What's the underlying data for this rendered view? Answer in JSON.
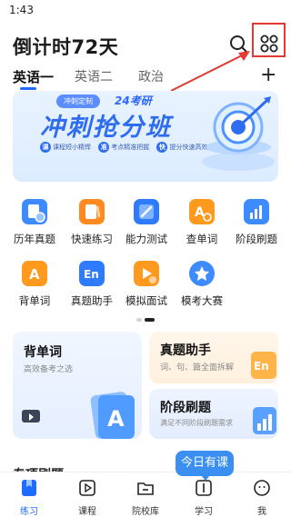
{
  "status_bar": {
    "time": "1:43"
  },
  "header": {
    "title": "倒计时72天",
    "search_icon": "search-icon",
    "apps_icon": "apps-grid-icon"
  },
  "annotation": {
    "highlight_color": "#e53935"
  },
  "tabs": [
    {
      "label": "英语一",
      "active": true
    },
    {
      "label": "英语二",
      "active": false
    },
    {
      "label": "政治",
      "active": false
    }
  ],
  "add_tab_label": "+",
  "banner": {
    "badge": "冲刺定制",
    "subtitle": "24考研",
    "title": "冲刺抢分班",
    "tags": [
      {
        "mark": "课",
        "text": "课程短小精悍"
      },
      {
        "mark": "准",
        "text": "考点精准把握"
      },
      {
        "mark": "快",
        "text": "提分快速高效"
      }
    ]
  },
  "grid": [
    {
      "label": "历年真题",
      "icon": "calendar-book-icon",
      "color": "#3d8bff"
    },
    {
      "label": "快速练习",
      "icon": "note-pen-icon",
      "color": "#ff8a1f"
    },
    {
      "label": "能力测试",
      "icon": "test-pen-icon",
      "color": "#2f7bff"
    },
    {
      "label": "查单词",
      "icon": "letter-a-search-icon",
      "color": "#ff9a1f"
    },
    {
      "label": "阶段刷题",
      "icon": "bar-chart-icon",
      "color": "#3d8bff"
    },
    {
      "label": "背单词",
      "icon": "letter-a-card-icon",
      "color": "#ff9a1f"
    },
    {
      "label": "真题助手",
      "icon": "en-card-icon",
      "color": "#2f7bff"
    },
    {
      "label": "模拟面试",
      "icon": "play-video-icon",
      "color": "#ff9a1f"
    },
    {
      "label": "模考大赛",
      "icon": "trophy-star-icon",
      "color": "#3d8bff"
    }
  ],
  "cards": {
    "vocab": {
      "title": "背单词",
      "subtitle": "高效备考之选"
    },
    "exam_helper": {
      "title": "真题助手",
      "subtitle": "词、句、篇全面拆解"
    },
    "stage_practice": {
      "title": "阶段刷题",
      "subtitle": "满足不同阶段刷题需求"
    }
  },
  "section_peek": "专项刷题",
  "today_bubble": "今日有课",
  "bottom_nav": [
    {
      "label": "练习",
      "icon": "practice-bookmark-icon",
      "active": true
    },
    {
      "label": "课程",
      "icon": "course-play-icon",
      "active": false
    },
    {
      "label": "院校库",
      "icon": "school-folder-icon",
      "active": false
    },
    {
      "label": "学习",
      "icon": "study-book-icon",
      "active": false
    },
    {
      "label": "我",
      "icon": "profile-face-icon",
      "active": false
    }
  ],
  "colors": {
    "accent": "#1f6bff",
    "bubble": "#3a8ff0"
  }
}
